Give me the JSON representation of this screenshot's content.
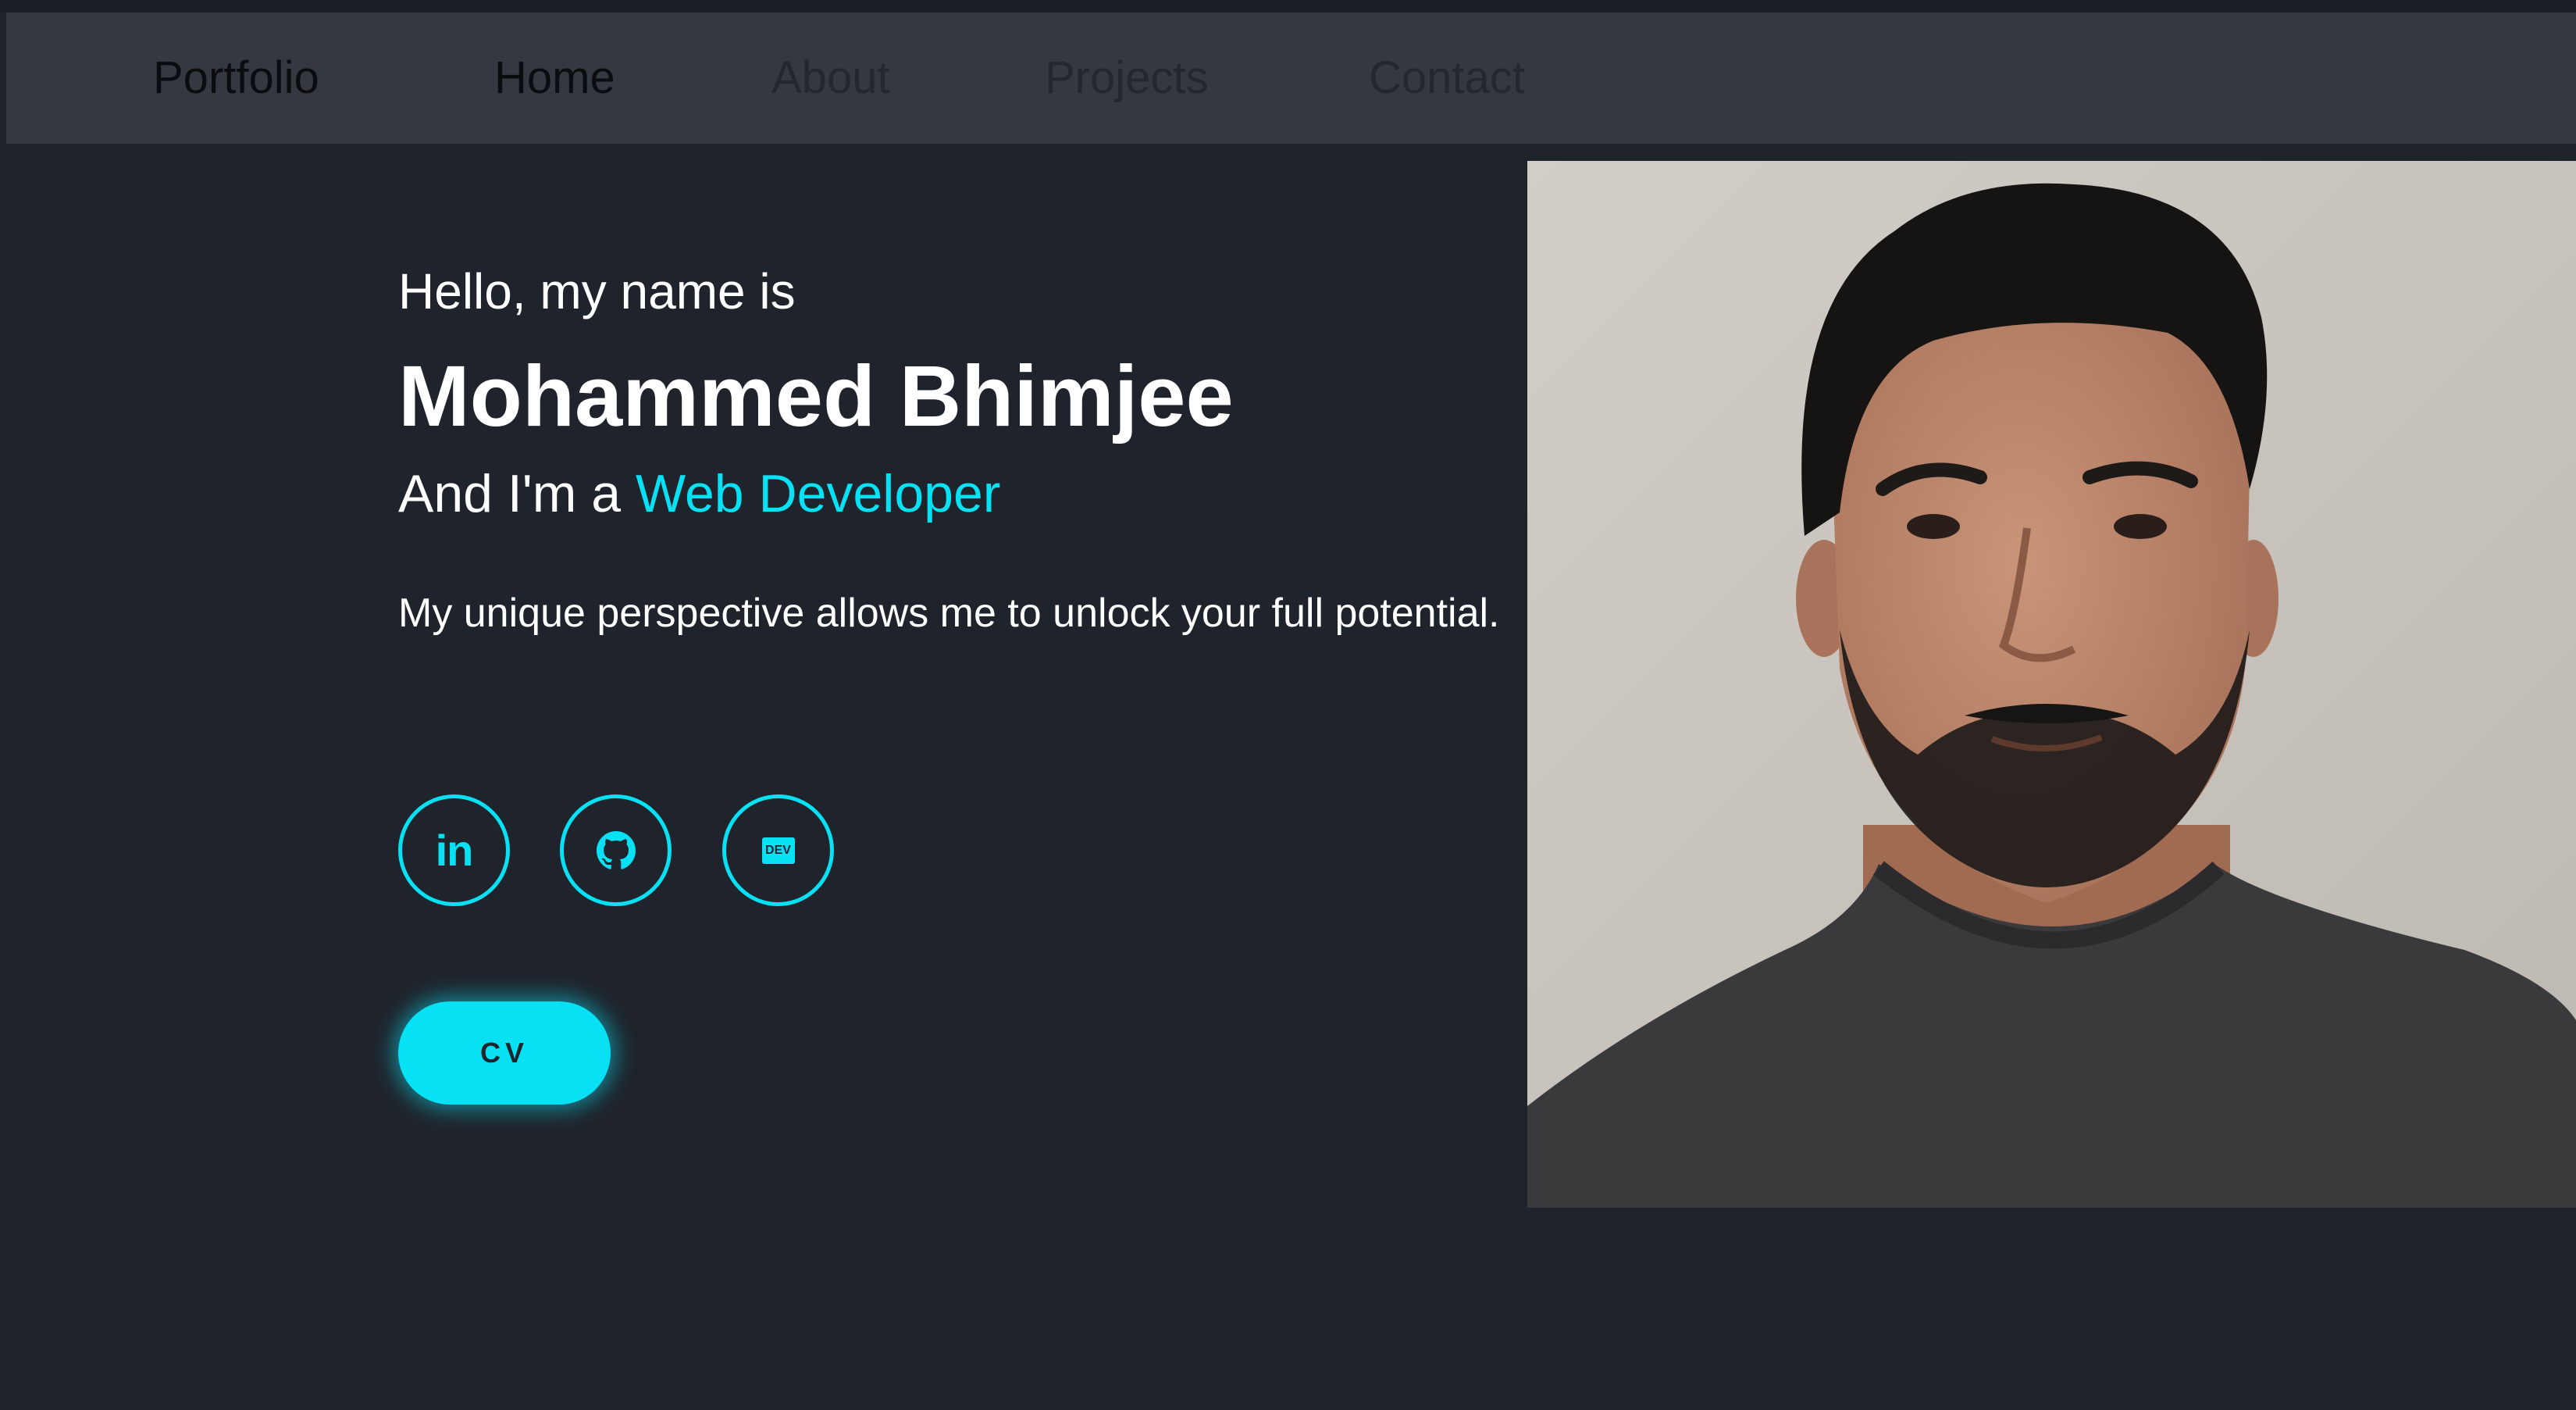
{
  "nav": {
    "brand": "Portfolio",
    "items": [
      {
        "label": "Home"
      },
      {
        "label": "About"
      },
      {
        "label": "Projects"
      },
      {
        "label": "Contact"
      }
    ]
  },
  "hero": {
    "greeting": "Hello, my name is",
    "name": "Mohammed Bhimjee",
    "role_prefix": "And I'm a ",
    "role_highlight": "Web Developer",
    "tagline": "My unique perspective allows me to unlock your full potential."
  },
  "social": {
    "linkedin_glyph": "in",
    "dev_glyph": "DEV"
  },
  "cv": {
    "label": "CV"
  },
  "colors": {
    "background": "#1f232b",
    "navbar": "#343840",
    "accent": "#08e0f4",
    "text": "#ffffff"
  },
  "icons": [
    "linkedin-icon",
    "github-icon",
    "dev-icon"
  ]
}
